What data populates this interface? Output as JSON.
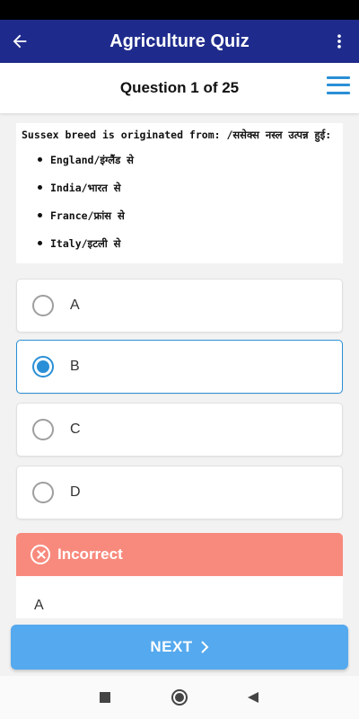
{
  "app_bar": {
    "title": "Agriculture Quiz",
    "back_icon": "arrow-left-icon",
    "more_icon": "more-vert-icon",
    "color": "#1f2b8c"
  },
  "question_header": {
    "counter": "Question 1 of 25",
    "menu_icon": "hamburger-menu-icon"
  },
  "question": {
    "text": "Sussex breed is originated from: /ससेक्स नस्ल उत्पन्न हुई:",
    "choices": [
      "England/इंग्लैंड से",
      "India/भारत से",
      "France/फ्रांस से",
      "Italy/इटली से"
    ]
  },
  "options": [
    {
      "label": "A",
      "selected": false
    },
    {
      "label": "B",
      "selected": true
    },
    {
      "label": "C",
      "selected": false
    },
    {
      "label": "D",
      "selected": false
    }
  ],
  "result": {
    "status": "Incorrect",
    "icon": "x-circle-icon",
    "correct_answer": "A",
    "color": "#f88a7d"
  },
  "next_button": {
    "label": "NEXT",
    "icon": "chevron-right-icon",
    "color": "#55a9ee"
  },
  "nav_bar": {
    "recents_icon": "square-icon",
    "home_icon": "circle-icon",
    "back_icon": "triangle-back-icon"
  },
  "colors": {
    "accent": "#2a8fd6"
  }
}
